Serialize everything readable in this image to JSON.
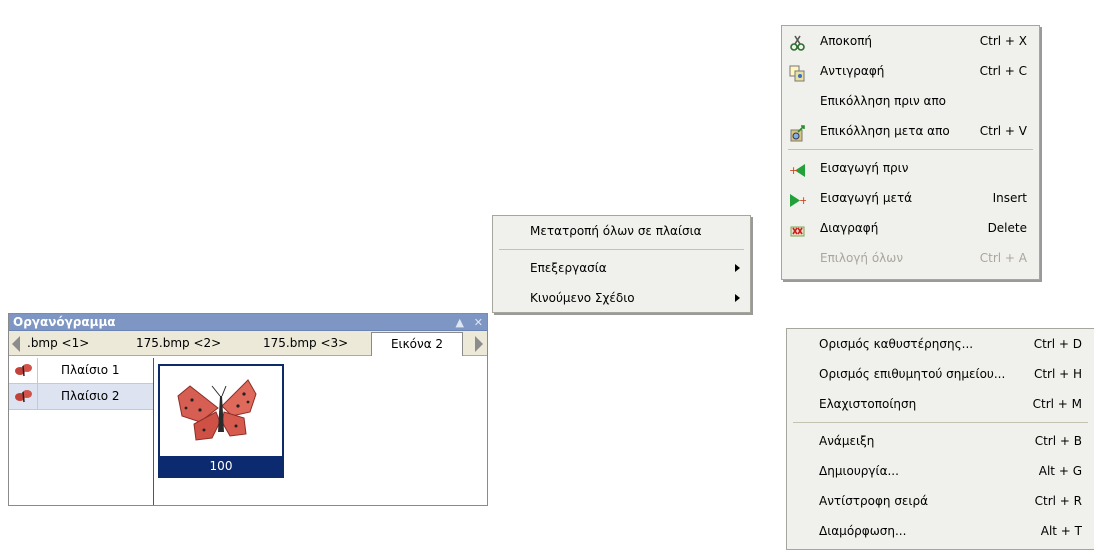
{
  "panel": {
    "title": "Οργανόγραμμα",
    "tabs": [
      ".bmp <1>",
      "175.bmp <2>",
      "175.bmp <3>",
      "Εικόνα 2"
    ],
    "frames": [
      "Πλαίσιο 1",
      "Πλαίσιο 2"
    ],
    "selected_frame_index": 1,
    "preview_value": "100"
  },
  "menu_convert": {
    "items": [
      {
        "label": "Μετατροπή όλων σε πλαίσια"
      },
      {
        "label": "Επεξεργασία",
        "submenu": true
      },
      {
        "label": "Κινούμενο Σχέδιο",
        "submenu": true
      }
    ]
  },
  "menu_edit": {
    "items": [
      {
        "label": "Αποκοπή",
        "shortcut": "Ctrl + X",
        "icon": "scissors-icon"
      },
      {
        "label": "Αντιγραφή",
        "shortcut": "Ctrl + C",
        "icon": "copy-icon"
      },
      {
        "label": "Επικόλληση πριν απο",
        "shortcut": ""
      },
      {
        "label": "Επικόλληση μετα απο",
        "shortcut": "Ctrl + V",
        "icon": "paste-after-icon"
      },
      {
        "label": "Εισαγωγή πριν",
        "shortcut": "",
        "icon": "insert-before-icon"
      },
      {
        "label": "Εισαγωγή μετά",
        "shortcut": "Insert",
        "icon": "insert-after-icon"
      },
      {
        "label": "Διαγραφή",
        "shortcut": "Delete",
        "icon": "delete-icon"
      },
      {
        "label": "Επιλογή όλων",
        "shortcut": "Ctrl + A",
        "disabled": true
      }
    ]
  },
  "menu_animation": {
    "items": [
      {
        "label": "Ορισμός καθυστέρησης...",
        "shortcut": "Ctrl + D"
      },
      {
        "label": "Ορισμός επιθυμητού σημείου...",
        "shortcut": "Ctrl + H"
      },
      {
        "label": "Ελαχιστοποίηση",
        "shortcut": "Ctrl + M"
      },
      {
        "label": "Ανάμειξη",
        "shortcut": "Ctrl + B"
      },
      {
        "label": "Δημιουργία...",
        "shortcut": "Alt + G"
      },
      {
        "label": "Αντίστροφη σειρά",
        "shortcut": "Ctrl + R"
      },
      {
        "label": "Διαμόρφωση...",
        "shortcut": "Alt + T"
      }
    ]
  },
  "colors": {
    "panel_title_bg": "#7d96c4",
    "selection_navy": "#0c2a6f",
    "menu_bg": "#f0f0ec",
    "disabled_text": "#aaa69a"
  }
}
